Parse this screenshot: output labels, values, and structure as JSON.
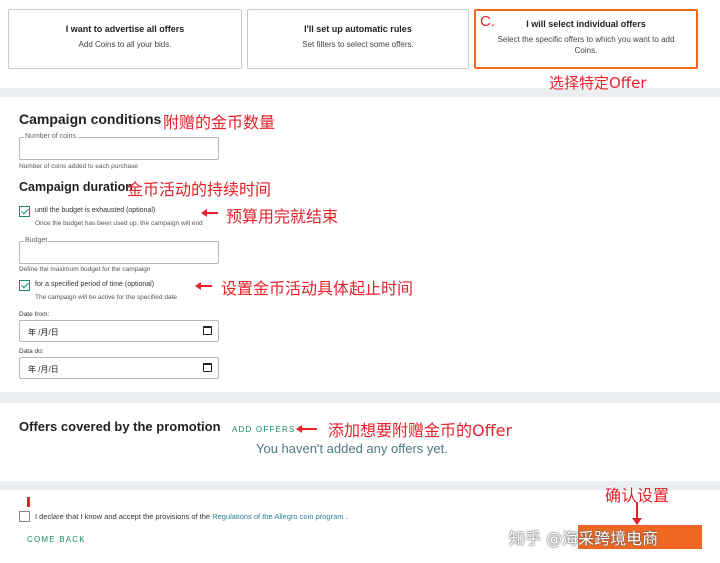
{
  "options": {
    "all": {
      "title": "I want to advertise all offers",
      "desc": "Add Coins to all your bids."
    },
    "rules": {
      "title": "I'll set up automatic rules",
      "desc": "Set filters to select some offers."
    },
    "individual": {
      "tag": "C.",
      "title": "I will select individual offers",
      "desc": "Select the specific offers to which you want to add Coins."
    }
  },
  "notes": {
    "select_offer": "选择特定Offer",
    "coin_amount": "附赠的金币数量",
    "duration": "金币活动的持续时间",
    "budget_end": "预算用完就结束",
    "period": "设置金币活动具体起止时间",
    "add_offers": "添加想要附赠金币的Offer",
    "confirm": "确认设置"
  },
  "conditions": {
    "title": "Campaign conditions",
    "coins_label": "Number of coins",
    "coins_value": "",
    "coins_hint": "Number of coins added to each purchase",
    "duration_title": "Campaign duration",
    "budget_check_label": "until the budget is exhausted (optional)",
    "budget_check_checked": true,
    "budget_check_hint": "Once the budget has been used up, the campaign will end",
    "budget_label": "Budget",
    "budget_value": "",
    "budget_hint": "Define the maximum budget for the campaign",
    "period_check_label": "for a specified period of time (optional)",
    "period_check_checked": true,
    "period_check_hint": "The campaign will be active for the specified date",
    "date_from_label": "Date from:",
    "date_from_value": "年 /月/日",
    "date_to_label": "Data do:",
    "date_to_value": "年 /月/日"
  },
  "offers": {
    "title": "Offers covered by the promotion",
    "add_button": "ADD OFFERS",
    "empty": "You haven't added any offers yet."
  },
  "footer": {
    "declare_prefix": "I declare that I know and accept the provisions of the ",
    "declare_link": "Regulations of the Allegro coin program",
    "declare_suffix": " .",
    "back_button": "COME BACK",
    "confirm_button": "",
    "watermark": "知乎 @海采跨境电商"
  },
  "colors": {
    "accent": "#f06722",
    "annotation": "#e8212b",
    "link": "#1a8a6a"
  }
}
